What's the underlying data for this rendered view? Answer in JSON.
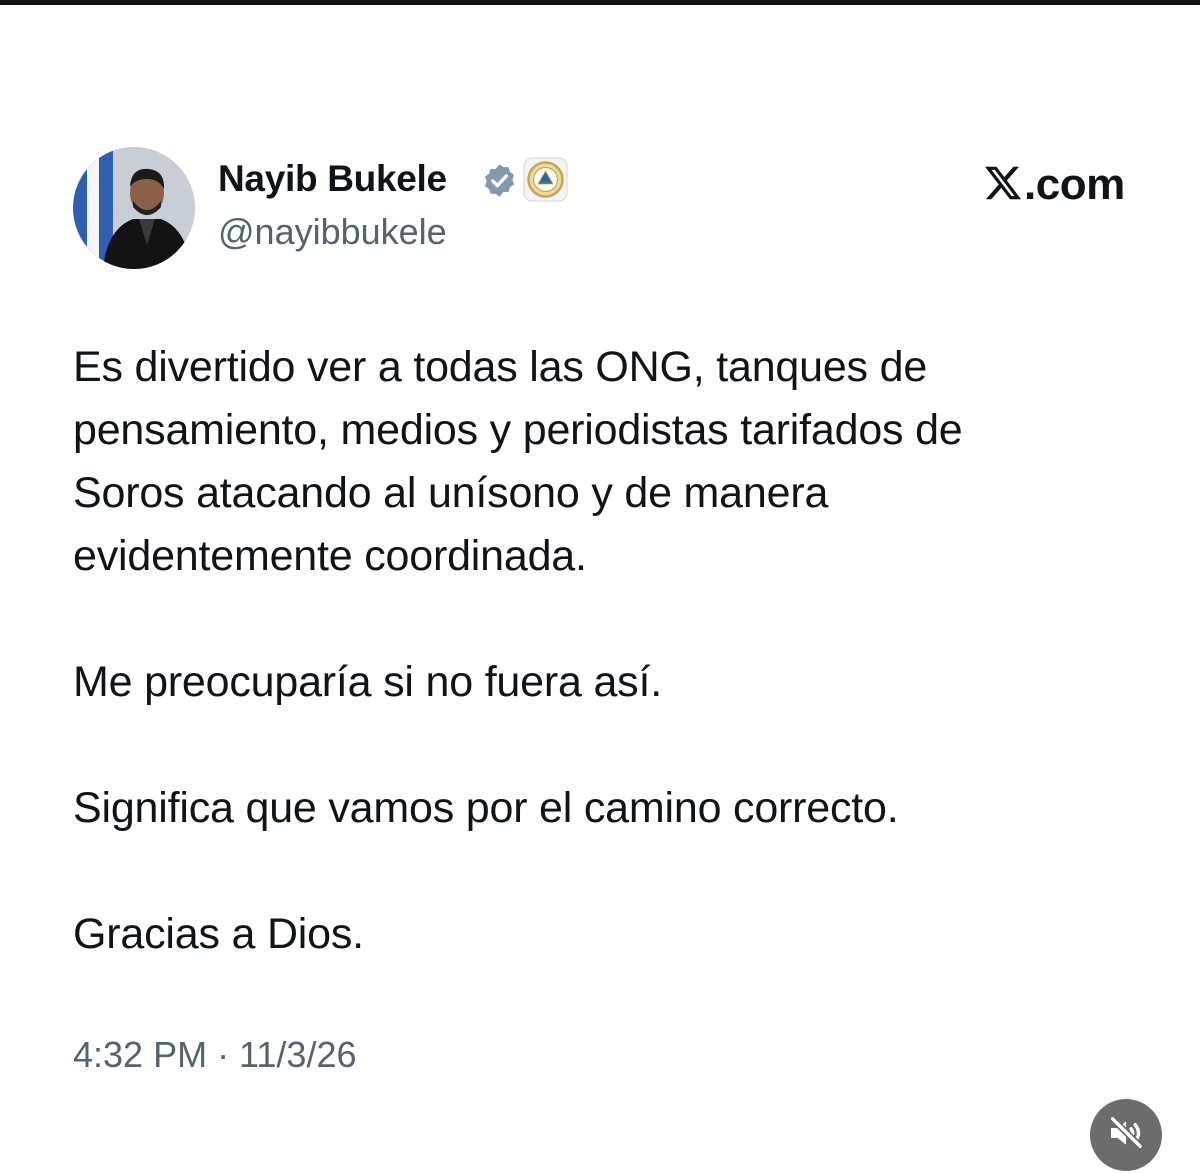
{
  "author": {
    "display_name": "Nayib Bukele",
    "handle": "@nayibbukele",
    "verified": true,
    "avatar_icon": "profile-photo",
    "affiliation_icon": "el-salvador-seal-icon"
  },
  "brand": {
    "logo_icon": "x-logo-icon",
    "site_label": ".com"
  },
  "post": {
    "paragraphs": [
      {
        "lines": [
          "Es divertido ver a todas las ONG, tanques de",
          "pensamiento, medios y periodistas tarifados de",
          "Soros atacando al unísono y de manera",
          "evidentemente coordinada."
        ]
      },
      {
        "lines": [
          "Me preocuparía si no fuera así."
        ]
      },
      {
        "lines": [
          "Significa que vamos por el camino correcto."
        ]
      },
      {
        "lines": [
          "Gracias a Dios."
        ]
      }
    ],
    "timestamp": "4:32 PM · 11/3/26"
  },
  "overlay": {
    "mute_icon": "speaker-muted-icon"
  },
  "colors": {
    "text_primary": "#0f1419",
    "text_secondary": "#536471",
    "verified_badge": "#829aab",
    "seal_gold": "#c9a646",
    "mute_button_bg": "#6c6c6c"
  }
}
